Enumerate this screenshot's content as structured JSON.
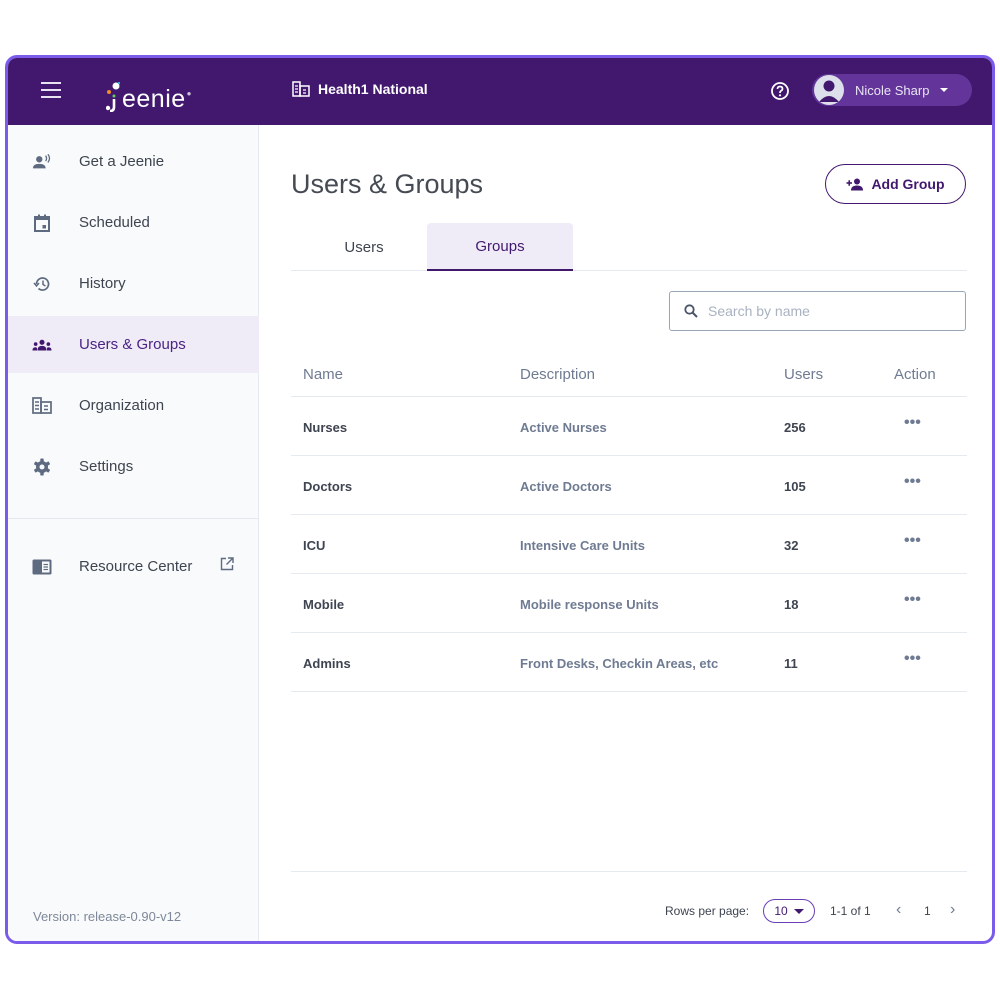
{
  "header": {
    "app_name": "Jeenie",
    "organization": "Health1 National",
    "user_name": "Nicole Sharp",
    "icons": {
      "menu": "hamburger-menu-icon",
      "org": "building-icon",
      "help": "help-circle-icon",
      "avatar": "account-circle-icon",
      "caret": "caret-down-icon"
    }
  },
  "sidebar": {
    "items": [
      {
        "label": "Get a Jeenie",
        "icon": "person-speaking-icon",
        "active": false
      },
      {
        "label": "Scheduled",
        "icon": "calendar-icon",
        "active": false
      },
      {
        "label": "History",
        "icon": "history-icon",
        "active": false
      },
      {
        "label": "Users & Groups",
        "icon": "groups-icon",
        "active": true
      },
      {
        "label": "Organization",
        "icon": "building-icon",
        "active": false
      },
      {
        "label": "Settings",
        "icon": "gear-icon",
        "active": false
      }
    ],
    "resource_center": {
      "label": "Resource Center",
      "icon": "book-icon",
      "external_icon": "external-link-icon"
    },
    "version": "Version: release-0.90-v12"
  },
  "main": {
    "title": "Users & Groups",
    "add_button": "Add Group",
    "tabs": [
      {
        "label": "Users",
        "active": false
      },
      {
        "label": "Groups",
        "active": true
      }
    ],
    "search": {
      "placeholder": "Search by name",
      "value": ""
    },
    "table": {
      "columns": [
        "Name",
        "Description",
        "Users",
        "Action"
      ],
      "rows": [
        {
          "name": "Nurses",
          "description": "Active Nurses",
          "users": "256",
          "action": "•••"
        },
        {
          "name": "Doctors",
          "description": "Active Doctors",
          "users": "105",
          "action": "•••"
        },
        {
          "name": "ICU",
          "description": "Intensive Care Units",
          "users": "32",
          "action": "•••"
        },
        {
          "name": "Mobile",
          "description": "Mobile response Units",
          "users": "18",
          "action": "•••"
        },
        {
          "name": "Admins",
          "description": "Front Desks, Checkin Areas, etc",
          "users": "11",
          "action": "•••"
        }
      ]
    },
    "pagination": {
      "rows_per_page_label": "Rows per page:",
      "rows_per_page": "10",
      "range": "1-1 of 1",
      "page": "1",
      "prev": "‹",
      "next": "›"
    }
  },
  "colors": {
    "brand_purple": "#42186f",
    "accent_border": "#7b5bea",
    "active_bg": "#efebf7"
  }
}
